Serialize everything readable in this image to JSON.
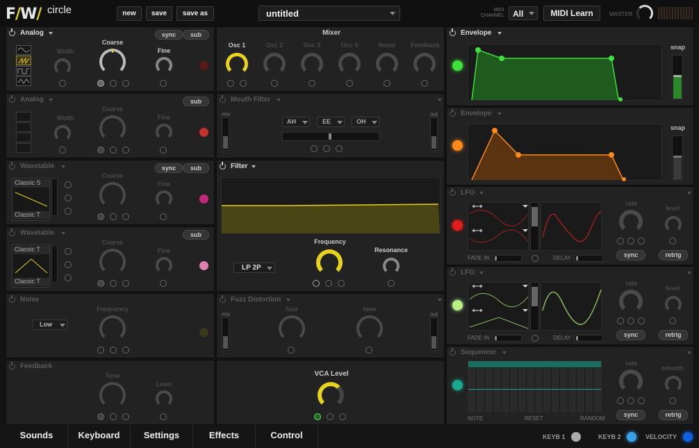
{
  "brand": {
    "logo": "F/W/",
    "product": "circle"
  },
  "toolbar": {
    "new": "new",
    "save": "save",
    "save_as": "save as",
    "preset": "untitled",
    "midi_channel_label": "MIDI\nCHANNEL",
    "midi_channel": "All",
    "midi_learn": "MIDI Learn",
    "master": "MASTER"
  },
  "osc": [
    {
      "title": "Analog",
      "width": "Width",
      "coarse": "Coarse",
      "fine": "Fine",
      "sync": "sync",
      "sub": "sub"
    },
    {
      "title": "Analog",
      "width": "Width",
      "coarse": "Coarse",
      "fine": "Fine",
      "sub": "sub"
    },
    {
      "title": "Wavetable",
      "coarse": "Coarse",
      "fine": "Fine",
      "sync": "sync",
      "sub": "sub",
      "table1": "Classic S",
      "table2": "Classic T"
    },
    {
      "title": "Wavetable",
      "coarse": "Coarse",
      "fine": "Fine",
      "sub": "sub",
      "table1": "Classic T",
      "table2": "Classic T"
    },
    {
      "title": "Noise",
      "frequency": "Frequency",
      "type": "Low"
    },
    {
      "title": "Feedback",
      "tune": "Tune",
      "level": "Level"
    }
  ],
  "mixer": {
    "title": "Mixer",
    "channels": [
      "Osc 1",
      "Osc 2",
      "Osc 3",
      "Osc 4",
      "Noise",
      "Feedback"
    ]
  },
  "mouth": {
    "title": "Mouth Filter",
    "mix": "mix",
    "out": "out",
    "v1": "AH",
    "v2": "EE",
    "v3": "OH"
  },
  "filter": {
    "title": "Filter",
    "frequency": "Frequency",
    "resonance": "Resonance",
    "type": "LP 2P"
  },
  "fuzz": {
    "title": "Fuzz Distortion",
    "fuzz": "fuzz",
    "tone": "tone",
    "mix": "mix",
    "out": "out"
  },
  "vca": {
    "title": "VCA Level"
  },
  "env": [
    {
      "title": "Envelope",
      "snap": "snap"
    },
    {
      "title": "Envelope",
      "snap": "snap"
    }
  ],
  "lfo": [
    {
      "title": "LFO",
      "fade_in": "FADE IN",
      "delay": "DELAY",
      "rate": "rate",
      "level": "level",
      "sync": "sync",
      "retrig": "retrig"
    },
    {
      "title": "LFO",
      "fade_in": "FADE IN",
      "delay": "DELAY",
      "rate": "rate",
      "level": "level",
      "sync": "sync",
      "retrig": "retrig"
    }
  ],
  "seq": {
    "title": "Sequencer",
    "note": "NOTE",
    "reset": "RESET",
    "random": "RANDOM",
    "rate": "rate",
    "smooth": "smooth",
    "sync": "sync",
    "retrig": "retrig"
  },
  "tabs": [
    "Sounds",
    "Keyboard",
    "Settings",
    "Effects",
    "Control"
  ],
  "status": {
    "keyb1": "KEYB 1",
    "keyb2": "KEYB 2",
    "velocity": "VELOCITY"
  },
  "colors": {
    "accent": "#e8d21c",
    "env1": "#3ee03e",
    "env2": "#ff8a1a",
    "lfo1": "#e01e1e",
    "lfo2": "#b8f08a",
    "seq": "#1aa890"
  }
}
